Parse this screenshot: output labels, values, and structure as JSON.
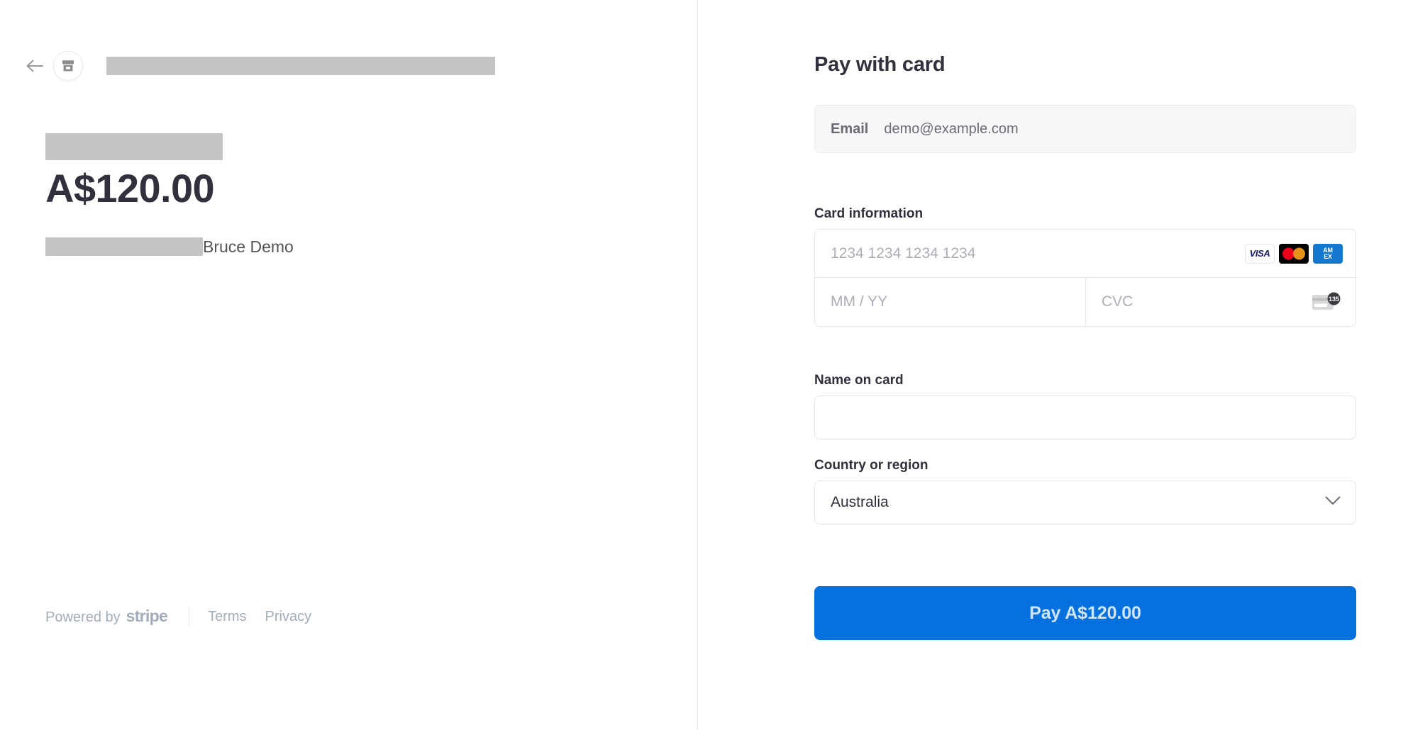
{
  "summary": {
    "back_label": "Back",
    "merchant_icon": "store-icon",
    "merchant_name_redacted": true,
    "amount_label_redacted": true,
    "amount": "A$120.00",
    "payer_label_redacted": true,
    "payer_name": "Bruce Demo",
    "footer": {
      "powered_by": "Powered by",
      "brand": "stripe",
      "terms": "Terms",
      "privacy": "Privacy"
    }
  },
  "form": {
    "title": "Pay with card",
    "email": {
      "label": "Email",
      "value": "demo@example.com"
    },
    "card": {
      "label": "Card information",
      "number_placeholder": "1234 1234 1234 1234",
      "expiry_placeholder": "MM / YY",
      "cvc_placeholder": "CVC",
      "cvc_hint_digits": "135",
      "brands": [
        {
          "name": "visa",
          "text": "VISA"
        },
        {
          "name": "mastercard",
          "text": ""
        },
        {
          "name": "amex",
          "line1": "AM",
          "line2": "EX"
        }
      ]
    },
    "name_on_card": {
      "label": "Name on card",
      "value": "",
      "placeholder": ""
    },
    "country": {
      "label": "Country or region",
      "value": "Australia"
    },
    "submit_label": "Pay A$120.00"
  },
  "colors": {
    "accent": "#0570de",
    "text": "#30313d",
    "muted": "#6d6d78",
    "placeholder": "#adadb8",
    "redaction": "#c4c4c4",
    "border": "#e6e6e9"
  }
}
